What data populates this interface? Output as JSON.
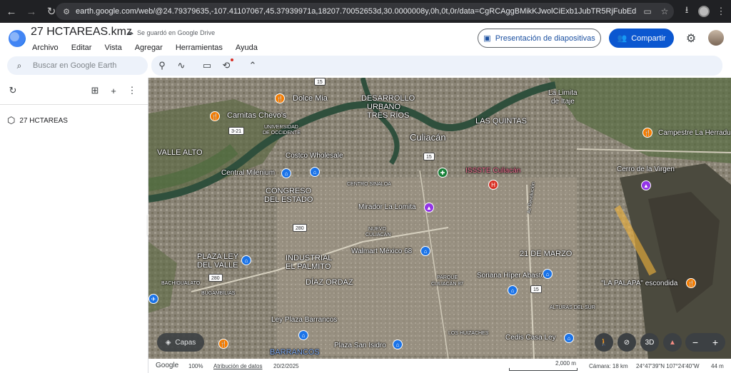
{
  "browser": {
    "url": "earth.google.com/web/@24.79379635,-107.41107067,45.37939971a,18207.70052653d,30.0000008y,0h,0t,0r/data=CgRCAggBMikKJwolCiExb1JubTR5RjFubEdpT2pDV25fdV9yLWxFMXltQ3hqS"
  },
  "header": {
    "doc_title": "27 HCTAREAS.kmz",
    "saved_status": "Se guardó en Google Drive",
    "menus": [
      "Archivo",
      "Editar",
      "Vista",
      "Agregar",
      "Herramientas",
      "Ayuda"
    ],
    "presentation_label": "Presentación de diapositivas",
    "share_label": "Compartir"
  },
  "search": {
    "placeholder": "Buscar en Google Earth"
  },
  "sidebar": {
    "project_name": "27 HCTAREAS"
  },
  "map": {
    "labels": [
      {
        "text": "Dolce Mia",
        "style": "big"
      },
      {
        "text": "DESARROLLO",
        "style": "big"
      },
      {
        "text": "URBANO",
        "style": "big"
      },
      {
        "text": "TRES RÍOS",
        "style": "big"
      },
      {
        "text": "La Limita",
        "style": ""
      },
      {
        "text": "de Itaje",
        "style": ""
      },
      {
        "text": "Carnitas Chevo's",
        "style": "big"
      },
      {
        "text": "UNIVERSIDAD",
        "style": "sm"
      },
      {
        "text": "DE OCCIDENTE",
        "style": "sm"
      },
      {
        "text": "Culiacán",
        "style": "xl"
      },
      {
        "text": "LAS QUINTAS",
        "style": "big"
      },
      {
        "text": "Campestre La Herradu",
        "style": ""
      },
      {
        "text": "VALLE ALTO",
        "style": "big"
      },
      {
        "text": "Costco Wholesale",
        "style": ""
      },
      {
        "text": "Cerro de la Virgen",
        "style": ""
      },
      {
        "text": "ISSSTE Culiacán",
        "style": "pink"
      },
      {
        "text": "Central Milenium",
        "style": ""
      },
      {
        "text": "CENTRO SINALOA",
        "style": "sm"
      },
      {
        "text": "CONGRESO",
        "style": "big"
      },
      {
        "text": "DEL ESTADO",
        "style": "big"
      },
      {
        "text": "Mirador La Lomita",
        "style": ""
      },
      {
        "text": "NUEVO",
        "style": "sm"
      },
      {
        "text": "CULIACÁN",
        "style": "sm"
      },
      {
        "text": "Walmart México 68",
        "style": ""
      },
      {
        "text": "21 DE MARZO",
        "style": "big"
      },
      {
        "text": "PLAZA LEY",
        "style": "big"
      },
      {
        "text": "DEL VALLE",
        "style": "big"
      },
      {
        "text": "INDUSTRIAL",
        "style": "big"
      },
      {
        "text": "EL PALMITO",
        "style": "big"
      },
      {
        "text": "Soriana Híper Abastos",
        "style": ""
      },
      {
        "text": "BACHIGUALATO",
        "style": "sm"
      },
      {
        "text": "DÍAZ ORDAZ",
        "style": "big"
      },
      {
        "text": "PARQUE",
        "style": "sm"
      },
      {
        "text": "CULIACÁN 87",
        "style": "sm"
      },
      {
        "text": "\"LA PALAPA\" escondida",
        "style": ""
      },
      {
        "text": "BUGAMBILIAS",
        "style": "sm"
      },
      {
        "text": "Av Revolución",
        "style": "sm"
      },
      {
        "text": "ALTURAS DEL SUR",
        "style": "sm"
      },
      {
        "text": "Ley Plaza Barrancos",
        "style": ""
      },
      {
        "text": "LOS HUIZACHES",
        "style": "sm"
      },
      {
        "text": "Cedis Casa Ley",
        "style": ""
      },
      {
        "text": "Plaza San Isidro",
        "style": ""
      },
      {
        "text": "BARRANCOS",
        "style": "big"
      }
    ],
    "shields": [
      "15",
      "3-21",
      "15",
      "280",
      "280",
      "15"
    ],
    "layers_label": "Capas",
    "view_3d_label": "3D"
  },
  "status_bar": {
    "brand": "Google",
    "zoom": "100%",
    "attribution": "Atribución de datos",
    "date": "20/2/2025",
    "scale": "2,000 m",
    "camera": "Cámara: 18 km",
    "coords": "24°47'39\"N 107°24'40\"W",
    "elevation": "44 m"
  },
  "colors": {
    "share_button": "#0b57d0",
    "presentation_text": "#1a4fa0",
    "toolbar_bg": "#edf2fa",
    "highlight_polygon": "#f6b73c"
  }
}
